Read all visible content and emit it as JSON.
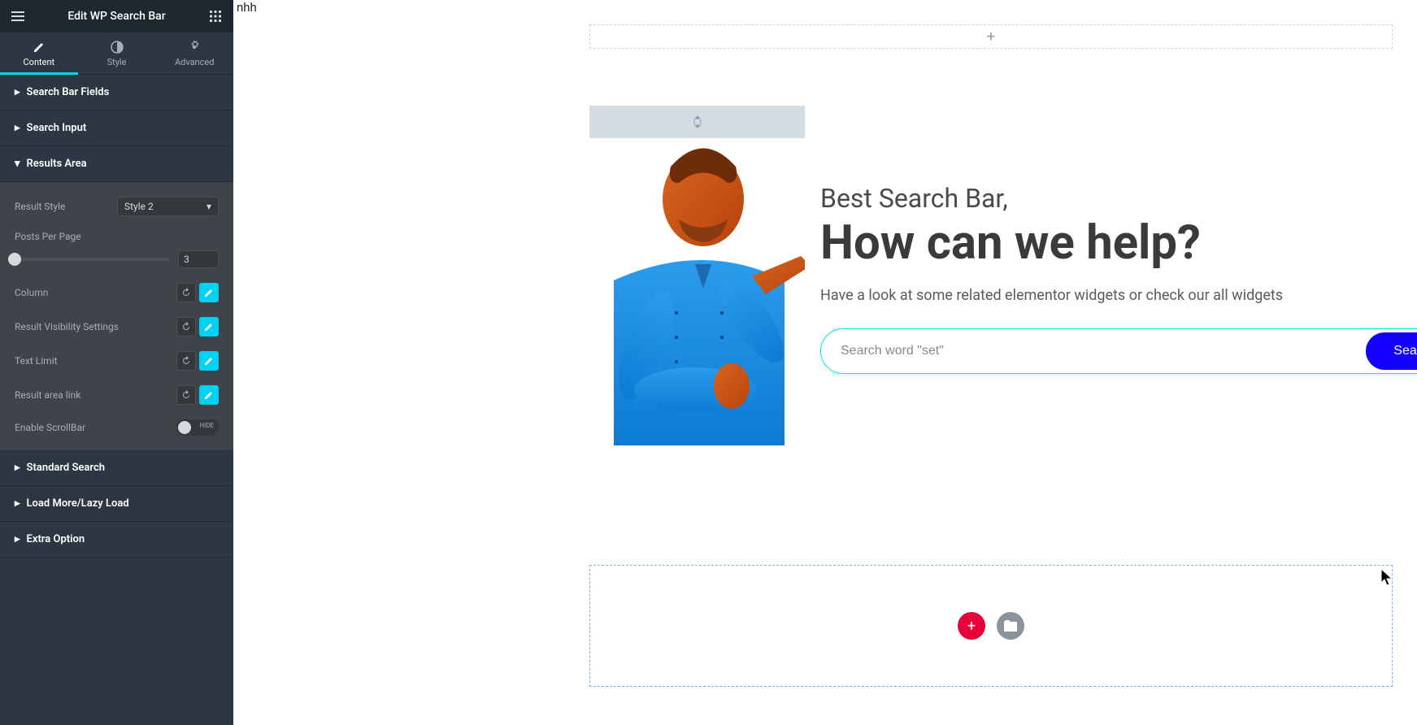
{
  "top_text": "nhh",
  "header": {
    "title": "Edit WP Search Bar"
  },
  "tabs": [
    {
      "label": "Content"
    },
    {
      "label": "Style"
    },
    {
      "label": "Advanced"
    }
  ],
  "sections": {
    "fields": "Search Bar Fields",
    "input": "Search Input",
    "results": "Results Area",
    "standard": "Standard Search",
    "loadmore": "Load More/Lazy Load",
    "extra": "Extra Option"
  },
  "results": {
    "result_style_label": "Result Style",
    "result_style_value": "Style 2",
    "posts_per_page_label": "Posts Per Page",
    "posts_per_page_value": "3",
    "column_label": "Column",
    "visibility_label": "Result Visibility Settings",
    "text_limit_label": "Text Limit",
    "area_link_label": "Result area link",
    "scrollbar_label": "Enable ScrollBar",
    "scrollbar_toggle": "HIDE"
  },
  "hero": {
    "subtitle": "Best Search Bar,",
    "title": "How can we help?",
    "description": "Have a look at some related elementor widgets or check our all widgets",
    "search_placeholder": "Search word \"set\"",
    "search_button": "Search"
  }
}
